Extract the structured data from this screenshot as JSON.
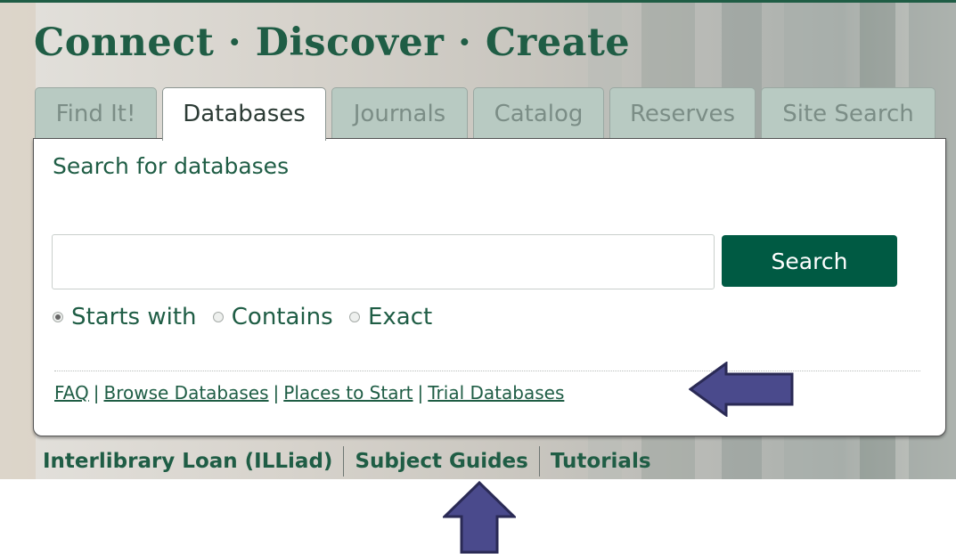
{
  "hero": {
    "title": "Connect · Discover · Create"
  },
  "tabs": [
    {
      "label": "Find It!",
      "active": false
    },
    {
      "label": "Databases",
      "active": true
    },
    {
      "label": "Journals",
      "active": false
    },
    {
      "label": "Catalog",
      "active": false
    },
    {
      "label": "Reserves",
      "active": false
    },
    {
      "label": "Site Search",
      "active": false
    }
  ],
  "panel": {
    "heading": "Search for databases",
    "search_value": "",
    "search_button": "Search",
    "match_options": [
      {
        "label": "Starts with",
        "checked": true
      },
      {
        "label": "Contains",
        "checked": false
      },
      {
        "label": "Exact",
        "checked": false
      }
    ],
    "links": [
      "FAQ",
      "Browse Databases",
      "Places to Start",
      "Trial Databases"
    ],
    "link_separator": "|"
  },
  "quick_links": [
    "Interlibrary Loan (ILLiad)",
    "Subject Guides",
    "Tutorials"
  ],
  "colors": {
    "brand_green": "#1f5d45",
    "button_green": "#005a43",
    "inactive_tab": "#b8cac2",
    "arrow_fill": "#4a4a8c",
    "arrow_stroke": "#2a2a55"
  },
  "annotations": {
    "right_arrow_icon": "arrow-left-icon",
    "bottom_arrow_icon": "arrow-up-icon"
  }
}
